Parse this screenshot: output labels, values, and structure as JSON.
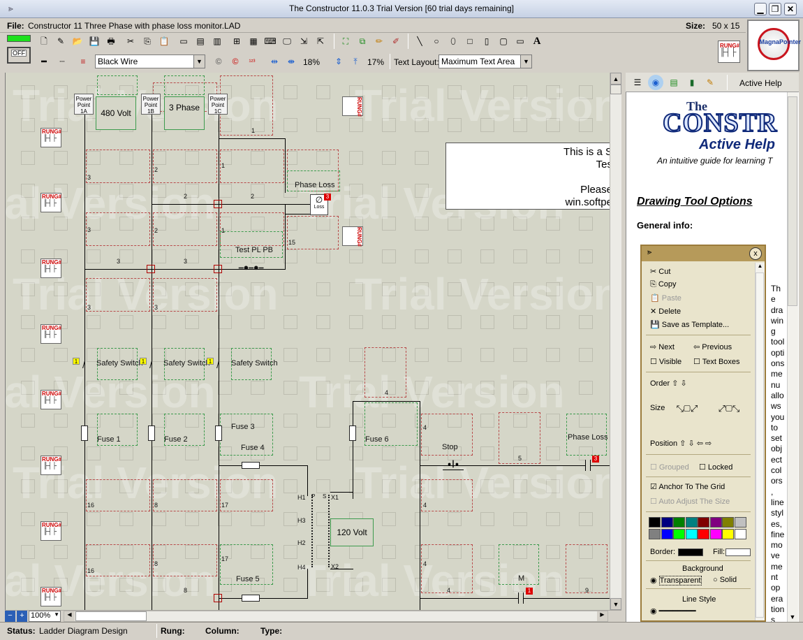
{
  "app": {
    "title": "The Constructor 11.0.3 Trial Version  [60 trial days remaining]"
  },
  "filebar": {
    "file_label": "File:",
    "file_name": "Constructor 11 Three Phase with phase loss monitor.LAD",
    "size_label": "Size:",
    "size_value": "50 x 15"
  },
  "toolbar": {
    "off_label": "OFF",
    "wire_type": "Black Wire",
    "zoom_h": "18%",
    "zoom_v": "17%",
    "text_layout_label": "Text Layout:",
    "text_layout_value": "Maximum Text Area",
    "rung_icon": "RUNG#",
    "magna_logo": "MagnaPointer"
  },
  "diagram": {
    "watermark": "Trial Version",
    "power_points": [
      {
        "label": "Power Point 1A"
      },
      {
        "label": "Power Point 1B"
      },
      {
        "label": "Power Point 1C"
      }
    ],
    "labels": {
      "volt480": "480 Volt",
      "phase3": "3 Phase",
      "phase_loss": "Phase Loss",
      "loss": "Loss",
      "test_pl_pb": "Test PL PB",
      "safety_switch": "Safety Switch",
      "fuse1": "Fuse 1",
      "fuse2": "Fuse 2",
      "fuse3": "Fuse 3",
      "fuse4": "Fuse 4",
      "fuse5": "Fuse 5",
      "fuse6": "Fuse 6",
      "stop": "Stop",
      "phase_loss_monitor": "Phase Loss Monitor",
      "volt120": "120 Volt",
      "m": "M",
      "h1": "H1",
      "h2": "H2",
      "h3": "H3",
      "h4": "H4",
      "x1": "X1",
      "x2": "X2",
      "p": "P",
      "s": "S"
    },
    "numbers": {
      "n1": "1",
      "n2": "2",
      "n3": "3",
      "n4": "4",
      "n5": "5",
      "n8": "8",
      "n9": "9",
      "n15": "15",
      "n16": "16",
      "n17": "17"
    },
    "trial_note": {
      "line1": "This is a S",
      "line2": "Tes",
      "line3": "Please",
      "line4": "win.softpe"
    }
  },
  "help": {
    "active_help_label": "Active Help",
    "brand_the": "The",
    "brand_name": "CONSTR",
    "brand_sub": "Active Help",
    "tagline": "An intuitive guide for learning T",
    "section_title": "Drawing Tool Options",
    "general_info": "General info:",
    "side_text": [
      "Th",
      "e",
      "dra",
      "win",
      "g",
      "tool",
      "opti",
      "ons",
      "me",
      "nu",
      "allo",
      "ws",
      "you",
      "to",
      "set",
      "obj",
      "ect",
      "col",
      "ors",
      ",",
      "line",
      "styl",
      "es,",
      "fine",
      "mo",
      "ve",
      "me",
      "nt",
      "op",
      "era",
      "tion",
      "s"
    ],
    "menu": {
      "cut": "Cut",
      "copy": "Copy",
      "paste": "Paste",
      "delete": "Delete",
      "save_template": "Save as Template...",
      "next": "Next",
      "previous": "Previous",
      "visible": "Visible",
      "text_boxes": "Text Boxes",
      "order": "Order",
      "size": "Size",
      "position": "Position",
      "grouped": "Grouped",
      "locked": "Locked",
      "anchor": "Anchor To The Grid",
      "auto_adjust": "Auto Adjust The Size",
      "border": "Border:",
      "fill": "Fill:",
      "background": "Background",
      "transparent": "Transparent",
      "solid": "Solid",
      "line_style": "Line Style"
    }
  },
  "colors": {
    "palette": [
      "#000000",
      "#000080",
      "#008000",
      "#008080",
      "#800000",
      "#800080",
      "#808000",
      "#c0c0c0",
      "#808080",
      "#0000ff",
      "#00ff00",
      "#00ffff",
      "#ff0000",
      "#ff00ff",
      "#ffff00",
      "#ffffff"
    ],
    "accent": "#3d9b4d",
    "alert": "#b00000"
  },
  "bottom": {
    "zoom": "100%"
  },
  "status": {
    "status_label": "Status:",
    "status_value": "Ladder Diagram Design",
    "rung_label": "Rung:",
    "column_label": "Column:",
    "type_label": "Type:"
  }
}
